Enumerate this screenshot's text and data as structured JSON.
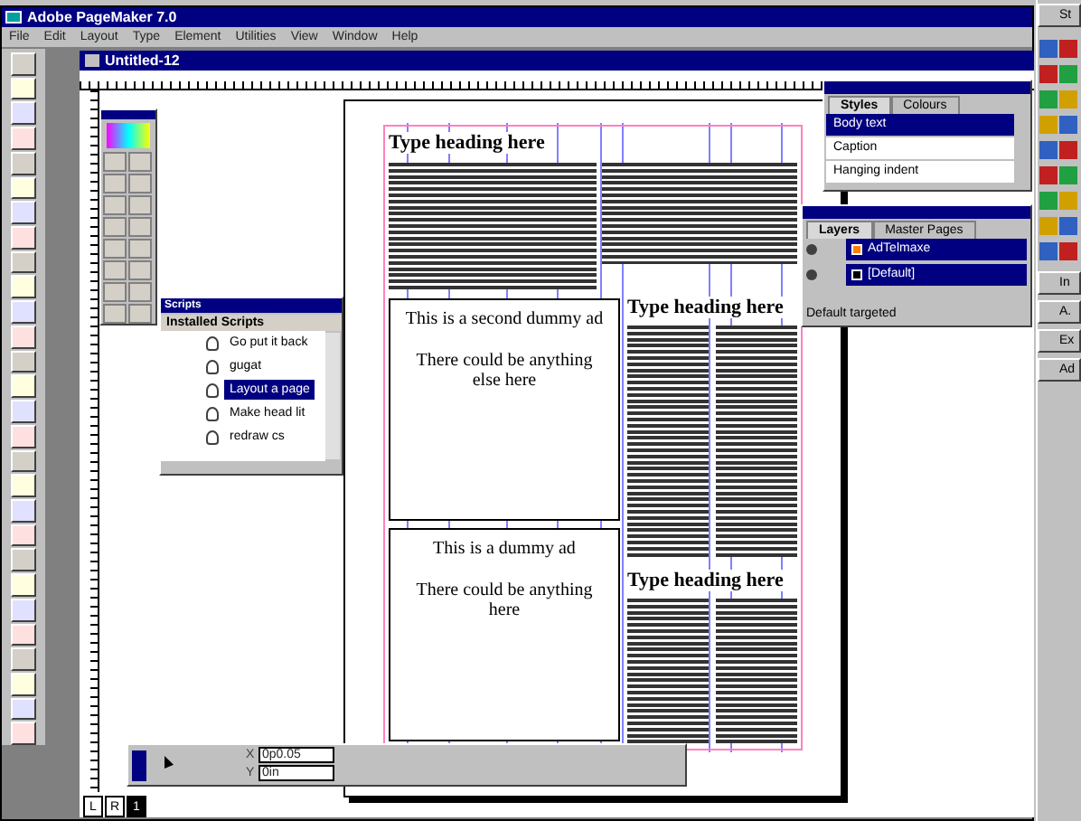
{
  "window": {
    "title": "Adobe PageMaker 7.0"
  },
  "menu": [
    "File",
    "Edit",
    "Layout",
    "Type",
    "Element",
    "Utilities",
    "View",
    "Window",
    "Help"
  ],
  "document": {
    "title": "Untitled-12"
  },
  "styles_panel": {
    "tabs": [
      {
        "label": "Styles",
        "selected": true
      },
      {
        "label": "Colours",
        "selected": false
      }
    ],
    "items": [
      {
        "name": "Body text",
        "selected": true
      },
      {
        "name": "Caption",
        "selected": false
      },
      {
        "name": "Hanging indent",
        "selected": false
      }
    ]
  },
  "layers_panel": {
    "tabs": [
      {
        "label": "Layers",
        "selected": true
      },
      {
        "label": "Master Pages",
        "selected": false
      }
    ],
    "layers": [
      {
        "name": "AdTelmaxe",
        "color": "#ff8000",
        "selected": true
      },
      {
        "name": "[Default]",
        "color": "#000000",
        "selected": true
      }
    ],
    "status": "Default targeted"
  },
  "scripts_panel": {
    "title": "Scripts",
    "header": "Installed Scripts",
    "items": [
      {
        "name": "Go put it back",
        "selected": false
      },
      {
        "name": "gugat",
        "selected": false
      },
      {
        "name": "Layout a page",
        "selected": true
      },
      {
        "name": "Make head lit",
        "selected": false
      },
      {
        "name": "redraw cs",
        "selected": false
      }
    ]
  },
  "page": {
    "headings": [
      "Type heading here",
      "Type heading here",
      "Type heading here"
    ],
    "ads": [
      {
        "title": "This is a second dummy ad",
        "body": "There could be anything else here"
      },
      {
        "title": "This is a dummy ad",
        "body": "There could be anything here"
      }
    ]
  },
  "control_palette": {
    "x_label": "X",
    "x_value": "0p0.05",
    "y_label": "Y",
    "y_value": "0in"
  },
  "page_tabs": [
    {
      "label": "L",
      "selected": false
    },
    {
      "label": "R",
      "selected": false
    },
    {
      "label": "1",
      "selected": true
    }
  ],
  "taskbar": [
    "St",
    "In",
    "A.",
    "Ex",
    "Ad"
  ]
}
